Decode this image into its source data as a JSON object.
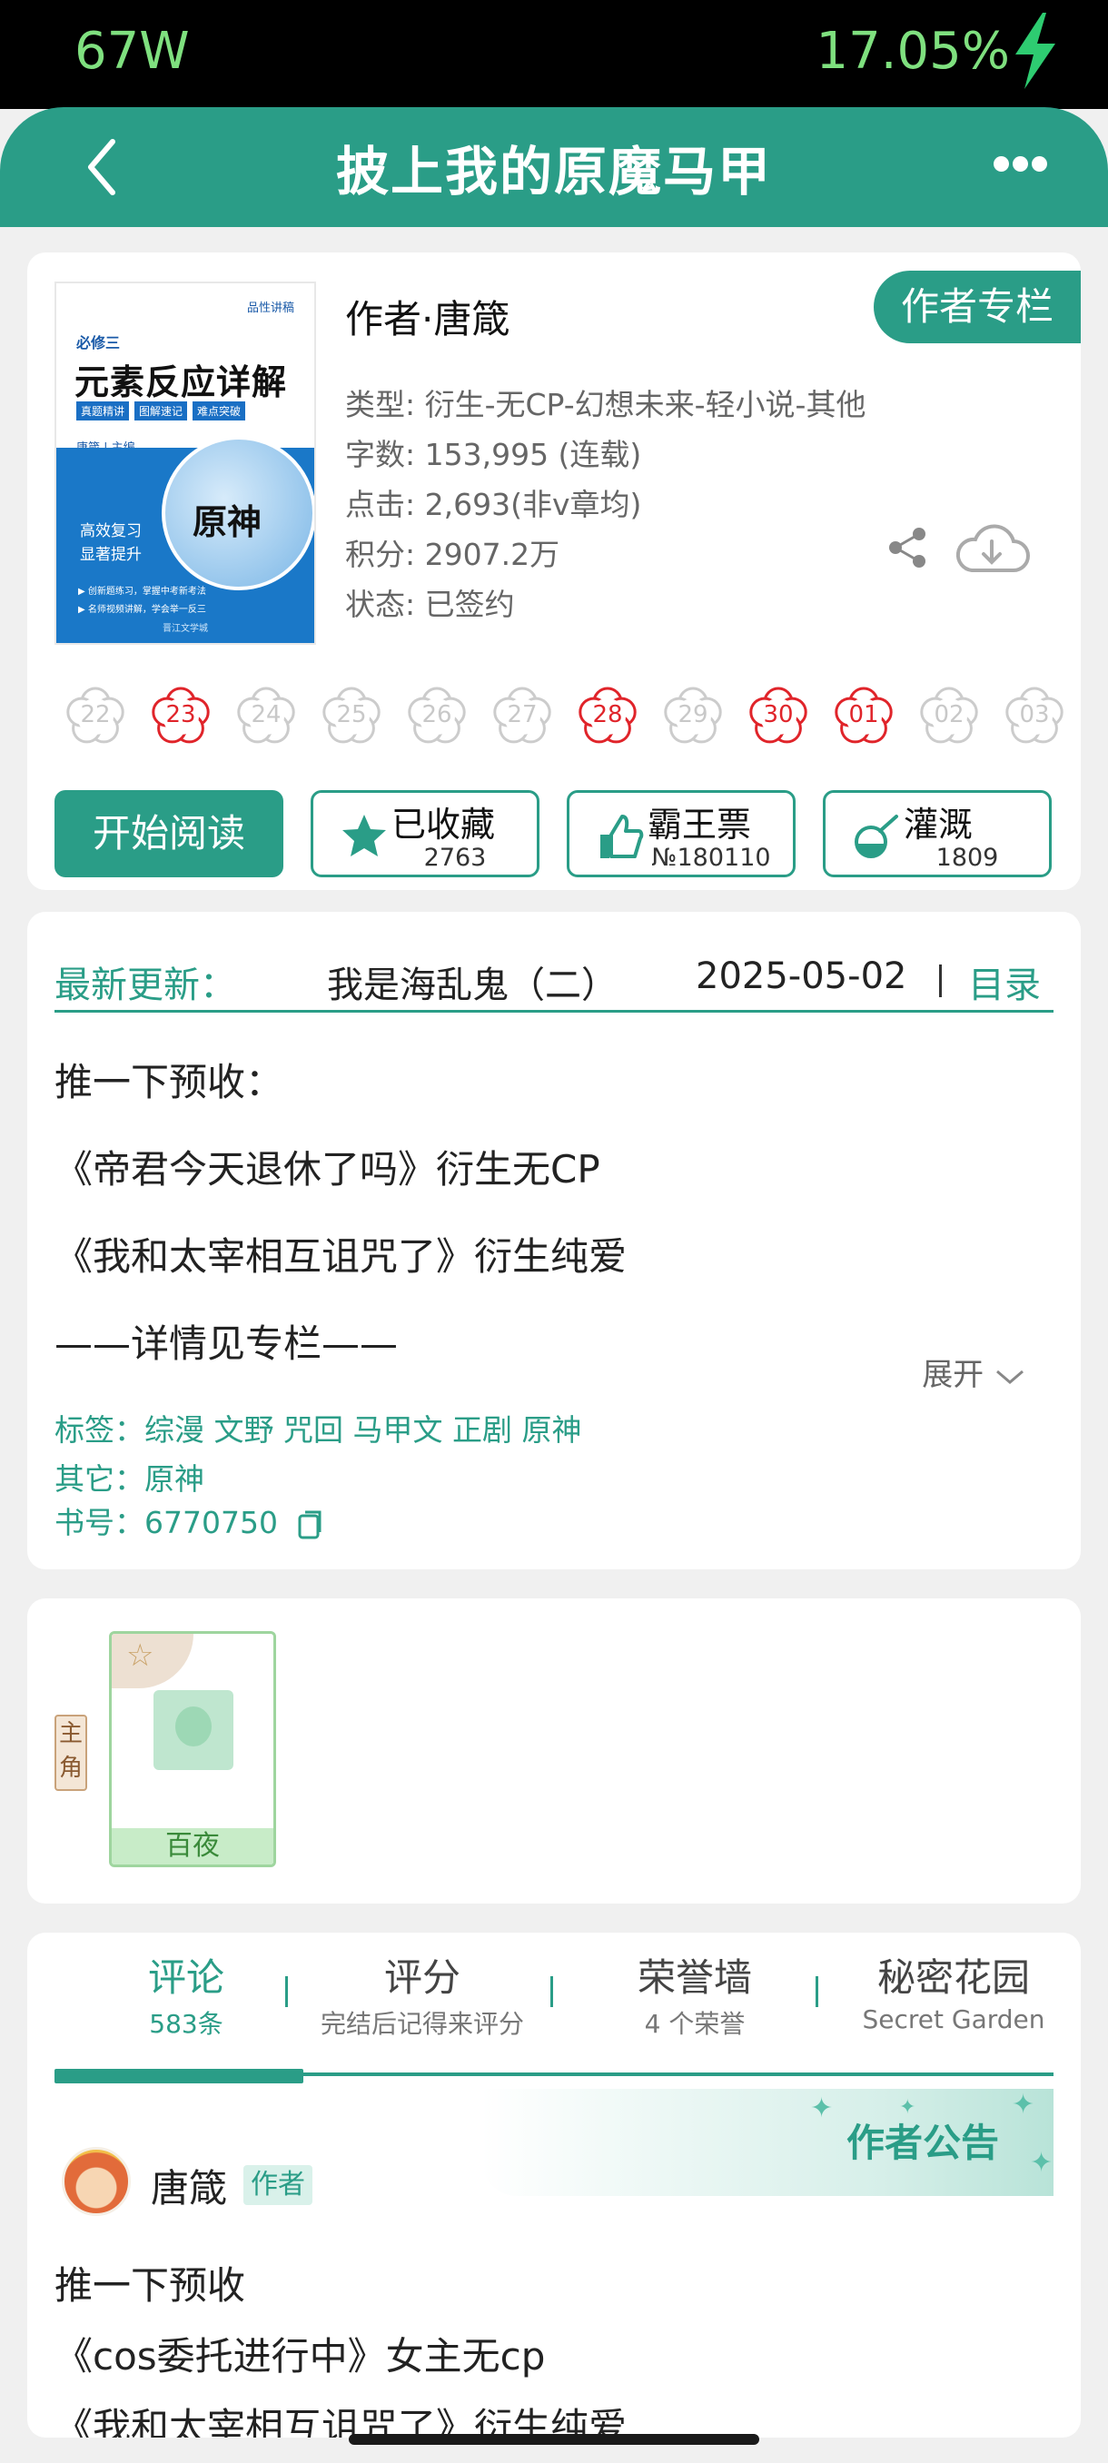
{
  "status": {
    "left": "67W",
    "right": "17.05%"
  },
  "nav": {
    "title": "披上我的原魔马甲"
  },
  "book": {
    "cover": {
      "publisher_tag": "品性讲稿",
      "subtitle": "必修三",
      "title": "元素反应详解",
      "tags": [
        "真题精讲",
        "图解速记",
        "难点突破"
      ],
      "editor": "唐箴 | 主编",
      "globe_text": "原神",
      "slogan1": "高效复习",
      "slogan2": "显著提升",
      "bullet1": "▶ 创新题练习，掌握中考新考法",
      "bullet2": "▶ 名师视频讲解，学会举一反三",
      "publisher": "晋江文学城"
    },
    "author": "作者·唐箴",
    "column_badge": "作者专栏",
    "meta": {
      "type": "类型: 衍生-无CP-幻想未来-轻小说-其他",
      "words": "字数: 153,995 (连载)",
      "clicks": "点击: 2,693(非v章均)",
      "points": "积分: 2907.2万",
      "state": "状态: 已签约"
    },
    "dates": [
      {
        "d": "22",
        "red": false
      },
      {
        "d": "23",
        "red": true
      },
      {
        "d": "24",
        "red": false
      },
      {
        "d": "25",
        "red": false
      },
      {
        "d": "26",
        "red": false
      },
      {
        "d": "27",
        "red": false
      },
      {
        "d": "28",
        "red": true
      },
      {
        "d": "29",
        "red": false
      },
      {
        "d": "30",
        "red": true
      },
      {
        "d": "01",
        "red": true
      },
      {
        "d": "02",
        "red": false
      },
      {
        "d": "03",
        "red": false
      }
    ],
    "buttons": {
      "read": "开始阅读",
      "collect_label": "已收藏",
      "collect_count": "2763",
      "ticket_label": "霸王票",
      "ticket_count": "№180110",
      "water_label": "灌溉",
      "water_count": "1809"
    }
  },
  "update": {
    "label": "最新更新：",
    "chapter": "我是海乱鬼（二）",
    "date": "2025-05-02",
    "toc": "目录",
    "intro": [
      "推一下预收：",
      "《帝君今天退休了吗》衍生无CP",
      "《我和太宰相互诅咒了》衍生纯爱",
      "——详情见专栏——"
    ],
    "expand": "展开",
    "tags": "标签：综漫 文野 咒回 马甲文 正剧 原神",
    "other": "其它：原神",
    "book_no": "书号：6770750"
  },
  "characters": {
    "role_tag": "主角",
    "name": "百夜"
  },
  "tabs": [
    {
      "t1": "评论",
      "t2": "583条"
    },
    {
      "t1": "评分",
      "t2": "完结后记得来评分"
    },
    {
      "t1": "荣誉墙",
      "t2": "4 个荣誉"
    },
    {
      "t1": "秘密花园",
      "t2": "Secret Garden"
    }
  ],
  "notice": {
    "title": "作者公告",
    "author": "唐箴",
    "badge": "作者",
    "lines": [
      "推一下预收",
      "《cos委托进行中》女主无cp",
      "《我和太宰相互诅咒了》衍生纯爱"
    ]
  },
  "colors": {
    "accent": "#2a9d87",
    "red": "#e0242a"
  }
}
